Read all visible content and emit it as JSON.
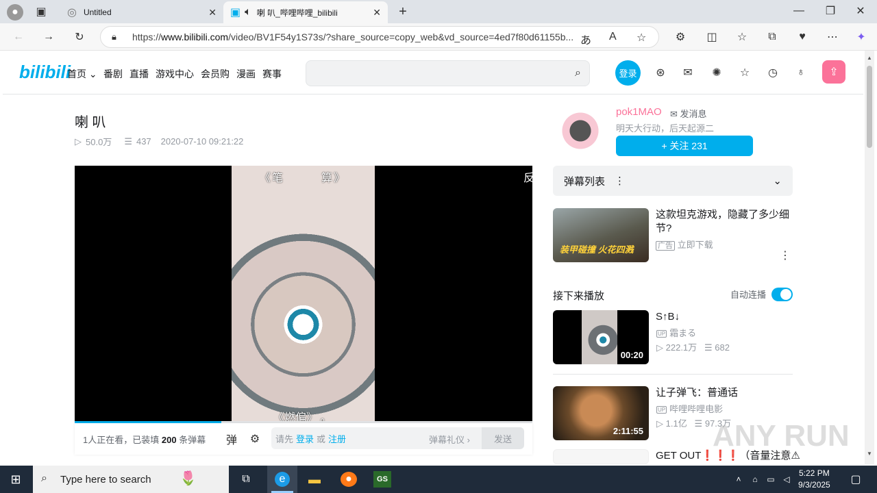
{
  "browser": {
    "tabs": [
      {
        "title": "Untitled"
      },
      {
        "title": "喇 叭_哔哩哔哩_bilibili"
      }
    ],
    "url_prefix": "https://",
    "url_domain": "www.bilibili.com",
    "url_rest": "/video/BV1F54y1S73s/?share_source=copy_web&vd_source=4ed7f80d61155b..."
  },
  "header": {
    "logo": "bilibili",
    "nav": [
      "首页",
      "番剧",
      "直播",
      "游戏中心",
      "会员购",
      "漫画",
      "赛事"
    ],
    "login_label": "登录"
  },
  "video": {
    "title": "喇 叭",
    "views": "50.0万",
    "danmaku": "437",
    "date": "2020-07-10 09:21:22",
    "subtitle_top": "《笔　　　算》",
    "subtitle_bottom": "《燃偏》 。",
    "corner_char": "反",
    "progress": 0.32
  },
  "danmaku_bar": {
    "count_prefix": "1人正在看，已装填",
    "count_num": "200",
    "count_suffix": "条弹幕",
    "placeholder_pre": "请先",
    "login": "登录",
    "or": "或",
    "register": "注册",
    "etiquette": "弹幕礼仪 ›",
    "send": "发送"
  },
  "uploader": {
    "name": "pok1MAO",
    "message": "发消息",
    "sign": "明天大行动，后天起源二",
    "follow": "+ 关注 231"
  },
  "danmaku_list": {
    "label": "弹幕列表"
  },
  "ad": {
    "title": "这款坦克游戏，隐藏了多少细节?",
    "badge": "广告",
    "action": "立即下载",
    "thumb_text": "装甲碰撞 火花四溅"
  },
  "next_up": {
    "label": "接下来播放",
    "autoplay": "自动连播",
    "autoplay_on": true
  },
  "recommendations": [
    {
      "title": "S↑B↓",
      "up": "霜まる",
      "views": "222.1万",
      "danmaku": "682",
      "duration": "00:20"
    },
    {
      "title": "让子弹飞：普通话",
      "up": "哔哩哔哩电影",
      "views": "1.1亿",
      "danmaku": "97.3万",
      "duration": "2:11:55"
    },
    {
      "title": "GET OUT❗❗❗（音量注意⚠"
    }
  ],
  "taskbar": {
    "search_placeholder": "Type here to search",
    "time": "5:22 PM",
    "date": "9/3/2025"
  },
  "watermark": "ANY RUN"
}
